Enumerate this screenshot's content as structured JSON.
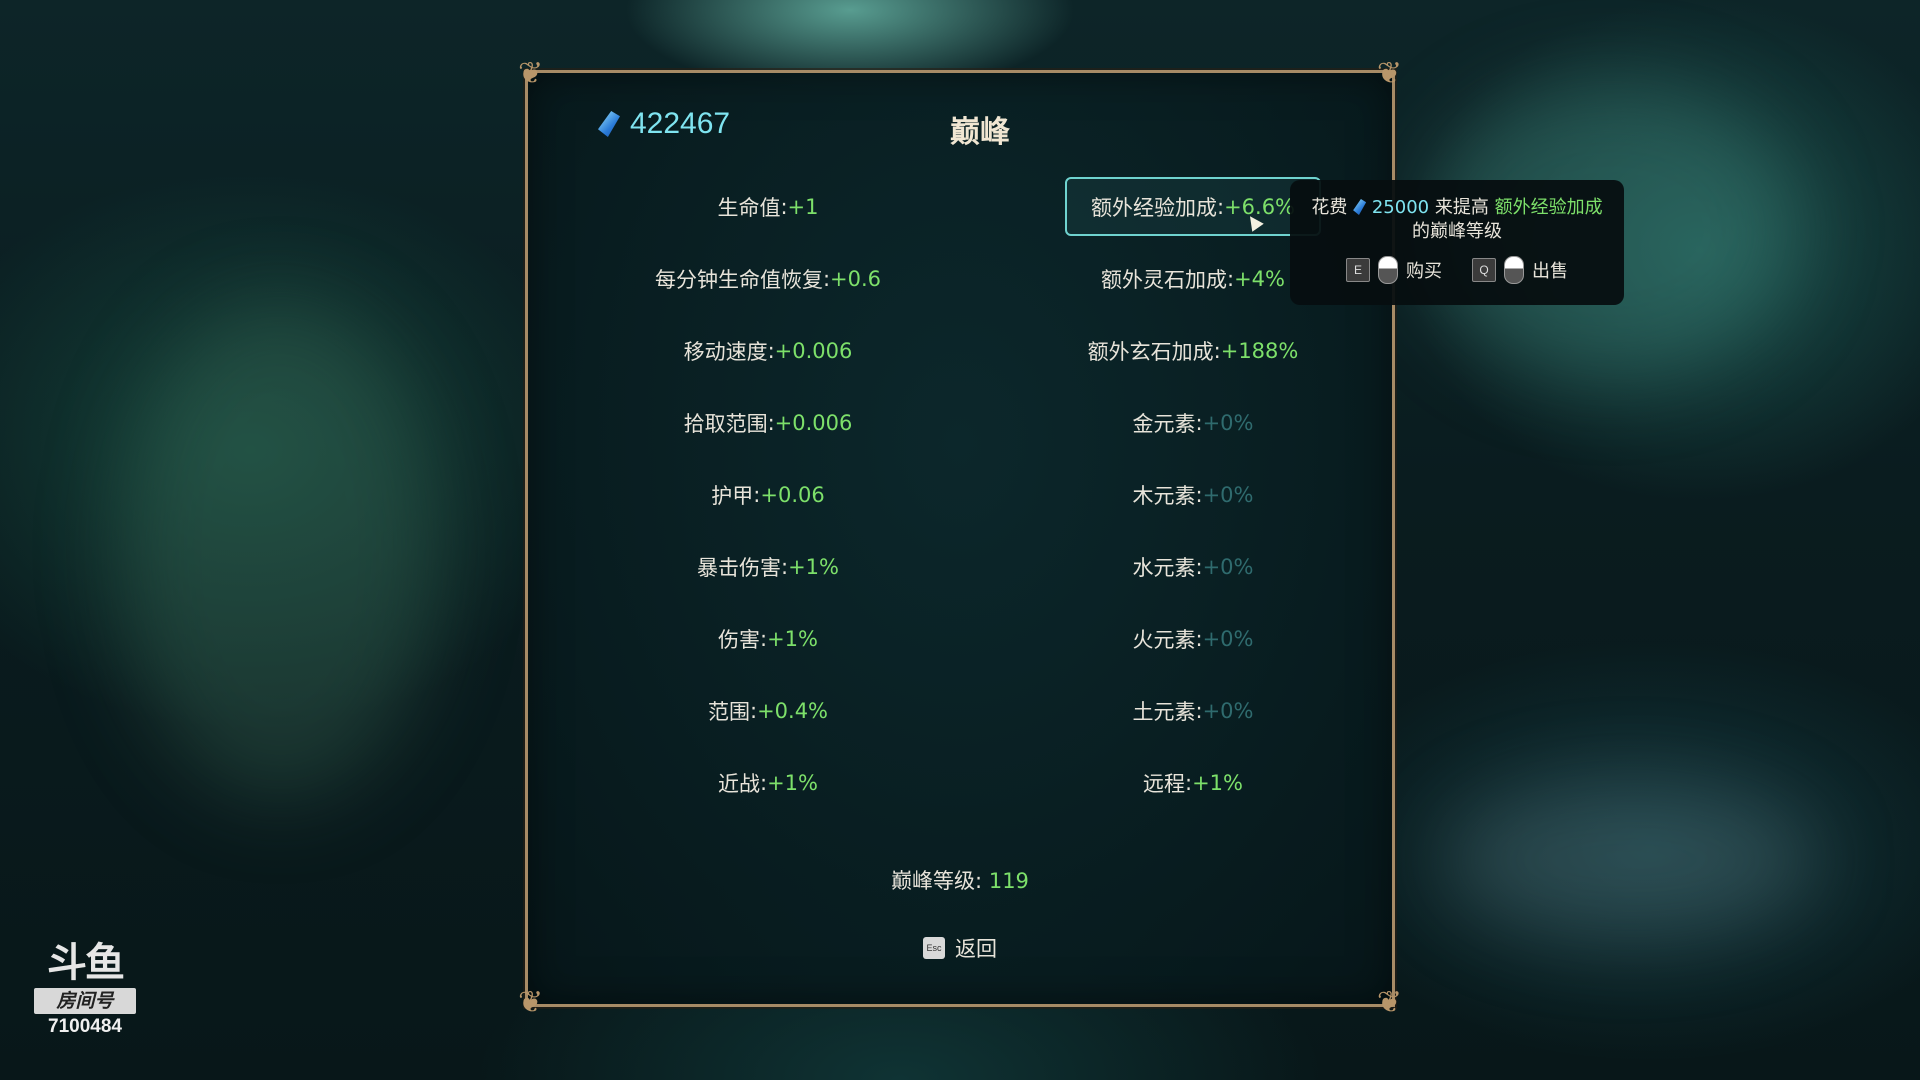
{
  "header": {
    "currency_icon": "blue-gem-icon",
    "currency_value": "422467",
    "title": "巅峰"
  },
  "left_stats": [
    {
      "label": "生命值",
      "value": "+1"
    },
    {
      "label": "每分钟生命值恢复",
      "value": "+0.6"
    },
    {
      "label": "移动速度",
      "value": "+0.006"
    },
    {
      "label": "拾取范围",
      "value": "+0.006"
    },
    {
      "label": "护甲",
      "value": "+0.06"
    },
    {
      "label": "暴击伤害",
      "value": "+1%"
    },
    {
      "label": "伤害",
      "value": "+1%"
    },
    {
      "label": "范围",
      "value": "+0.4%"
    },
    {
      "label": "近战",
      "value": "+1%"
    }
  ],
  "right_stats": [
    {
      "label": "额外经验加成",
      "value": "+6.6%",
      "selected": true
    },
    {
      "label": "额外灵石加成",
      "value": "+4%"
    },
    {
      "label": "额外玄石加成",
      "value": "+188%"
    },
    {
      "label": "金元素",
      "value": "+0%"
    },
    {
      "label": "木元素",
      "value": "+0%"
    },
    {
      "label": "水元素",
      "value": "+0%"
    },
    {
      "label": "火元素",
      "value": "+0%"
    },
    {
      "label": "土元素",
      "value": "+0%"
    },
    {
      "label": "远程",
      "value": "+1%"
    }
  ],
  "separator": ": ",
  "peak_level": {
    "label": "巅峰等级: ",
    "value": "119"
  },
  "back": {
    "key": "Esc",
    "label": "返回"
  },
  "tooltip": {
    "prefix": "花费",
    "cost": "25000",
    "middle": "来提高",
    "highlight": "额外经验加成",
    "suffix": "的巅峰等级",
    "buy_key": "E",
    "buy_label": "购买",
    "sell_key": "Q",
    "sell_label": "出售"
  },
  "watermark": {
    "logo": "斗鱼",
    "room_label": "房间号",
    "room_number": "7100484"
  },
  "colors": {
    "positive": "#7de06a",
    "zero": "#2f6b6e",
    "currency": "#7fe4f0",
    "border": "#a78b66"
  }
}
